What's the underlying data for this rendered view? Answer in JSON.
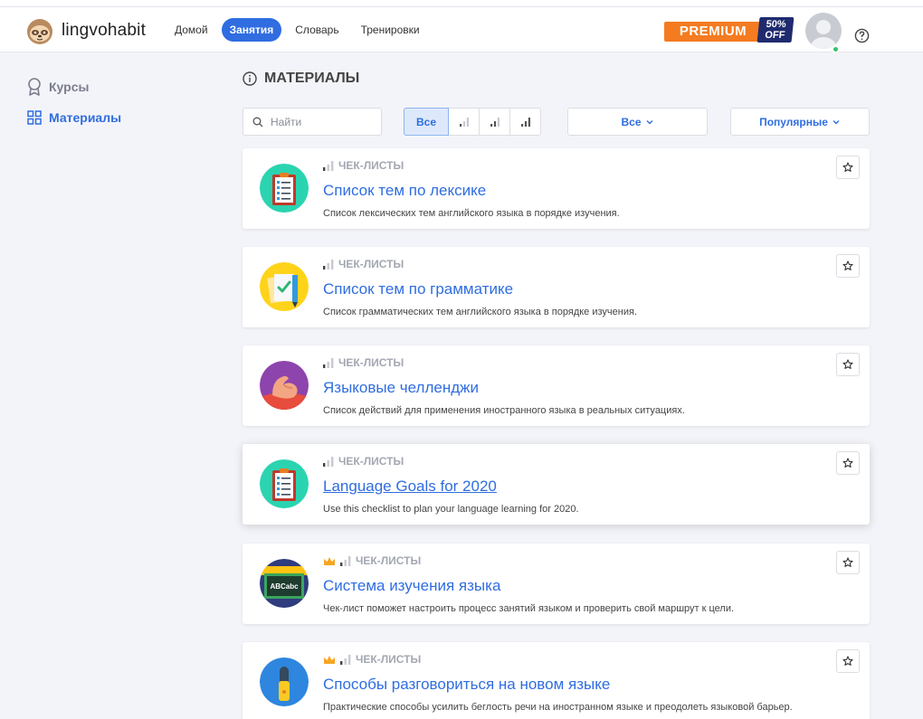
{
  "app": {
    "name": "lingvohabit"
  },
  "nav": [
    {
      "label": "Домой",
      "active": false
    },
    {
      "label": "Занятия",
      "active": true
    },
    {
      "label": "Словарь",
      "active": false
    },
    {
      "label": "Тренировки",
      "active": false
    }
  ],
  "premium": {
    "label": "PREMIUM",
    "discount_line1": "50%",
    "discount_line2": "OFF",
    "colors": {
      "orange": "#f47b20",
      "navy": "#1f2b6e"
    }
  },
  "sidebar": {
    "items": [
      {
        "label": "Курсы",
        "icon": "award-icon",
        "active": false
      },
      {
        "label": "Материалы",
        "icon": "grid-icon",
        "active": true
      }
    ]
  },
  "page": {
    "title": "МАТЕРИАЛЫ",
    "title_icon": "info-icon"
  },
  "filters": {
    "search_placeholder": "Найти",
    "level_all": "Все",
    "levels": [
      "level-1-icon",
      "level-2-icon",
      "level-3-icon"
    ],
    "type_dropdown": "Все",
    "sort_dropdown": "Популярные"
  },
  "accent": "#2f6de1",
  "cards": [
    {
      "category": "ЧЕК-ЛИСТЫ",
      "premium": false,
      "title": "Список тем по лексике",
      "description": "Список лексических тем английского языка в порядке изучения.",
      "icon": "checklist-icon"
    },
    {
      "category": "ЧЕК-ЛИСТЫ",
      "premium": false,
      "title": "Список тем по грамматике",
      "description": "Список грамматических тем английского языка в порядке изучения.",
      "icon": "grammar-document-icon"
    },
    {
      "category": "ЧЕК-ЛИСТЫ",
      "premium": false,
      "title": "Языковые челленджи",
      "description": "Список действий для применения иностранного языка в реальных ситуациях.",
      "icon": "muscle-arm-icon"
    },
    {
      "category": "ЧЕК-ЛИСТЫ",
      "premium": false,
      "title": "Language Goals for 2020",
      "description": "Use this checklist to plan your language learning for 2020.",
      "icon": "checklist-icon"
    },
    {
      "category": "ЧЕК-ЛИСТЫ",
      "premium": true,
      "title": "Система изучения языка",
      "description": "Чек-лист поможет настроить процесс занятий языком и проверить свой маршрут к цели.",
      "icon": "chalkboard-abc-icon",
      "board_text": "ABCabc"
    },
    {
      "category": "ЧЕК-ЛИСТЫ",
      "premium": true,
      "title": "Способы разговориться на новом языке",
      "description": "Практические способы усилить беглость речи на иностранном языке и преодолеть языковой барьер.",
      "icon": "microphone-icon"
    }
  ]
}
